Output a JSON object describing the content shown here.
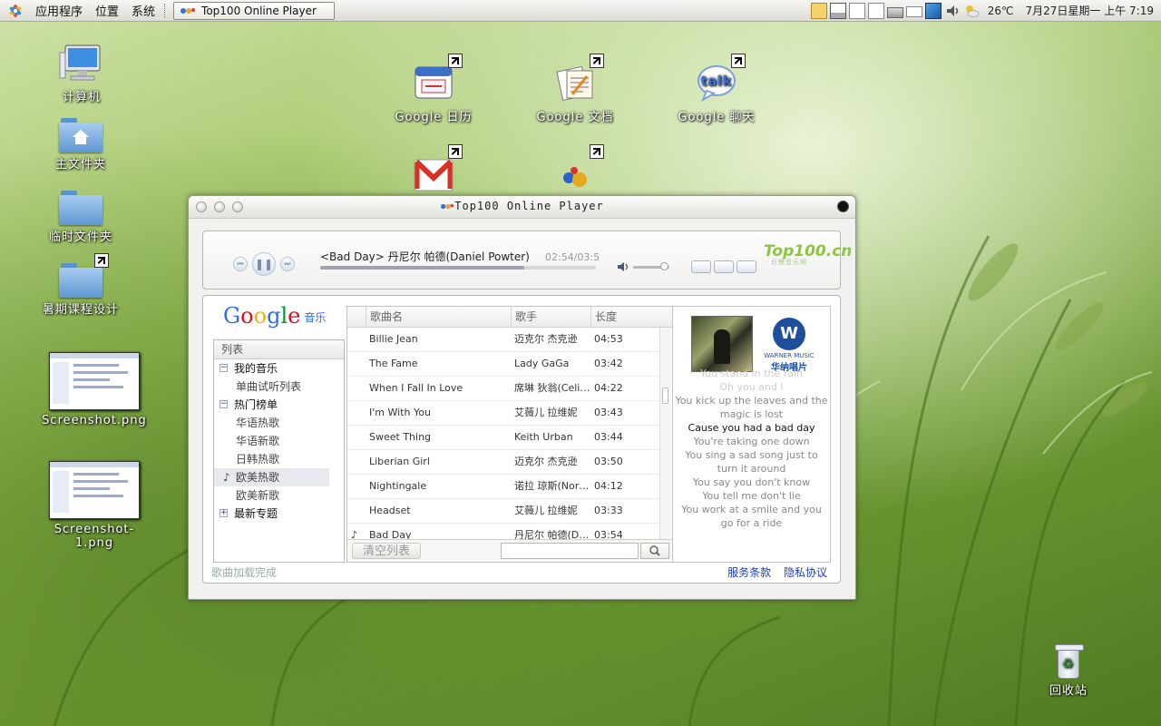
{
  "panel": {
    "menus": [
      "应用程序",
      "位置",
      "系统"
    ],
    "task_window": "Top100 Online Player",
    "weather": "26℃",
    "clock": "7月27日星期一 上午 7:19"
  },
  "desktop": {
    "icons_left": [
      "计算机",
      "主文件夹",
      "临时文件夹",
      "暑期课程设计"
    ],
    "thumb1": "Screenshot.png",
    "thumb2": "Screenshot-1.png",
    "google_calendar": "Google 日历",
    "google_docs": "Google 文档",
    "google_talk": "Google 聊天",
    "talk_bubble": "talk",
    "trash": "回收站"
  },
  "player": {
    "title": "Top100 Online Player",
    "now_playing": "<Bad Day>  丹尼尔 帕德(Daniel Powter)",
    "time": "02:54/03:5",
    "progress_fraction": 0.74,
    "volume_fraction": 0.85,
    "brand": "Top100.cn",
    "brand_sub": "巨鲸音乐网",
    "google_music": "音乐",
    "list_header": "列表",
    "tree": [
      {
        "label": "我的音乐",
        "type": "group",
        "toggle": "−"
      },
      {
        "label": "单曲试听列表",
        "type": "leaf"
      },
      {
        "label": "热门榜单",
        "type": "group",
        "toggle": "−"
      },
      {
        "label": "华语热歌",
        "type": "leaf"
      },
      {
        "label": "华语新歌",
        "type": "leaf"
      },
      {
        "label": "日韩热歌",
        "type": "leaf"
      },
      {
        "label": "欧美热歌",
        "type": "leaf",
        "active": true
      },
      {
        "label": "欧美新歌",
        "type": "leaf"
      },
      {
        "label": "最新专题",
        "type": "group",
        "toggle": "+"
      }
    ],
    "columns": [
      "歌曲名",
      "歌手",
      "长度"
    ],
    "songs": [
      {
        "title": "Billie Jean",
        "artist": "迈克尔 杰克逊",
        "length": "04:53"
      },
      {
        "title": "The Fame",
        "artist": "Lady GaGa",
        "length": "03:42"
      },
      {
        "title": "When I Fall In Love",
        "artist": "席琳 狄翁(Celine Dion)",
        "length": "04:22"
      },
      {
        "title": "I'm With You",
        "artist": "艾薇儿 拉维妮",
        "length": "03:43"
      },
      {
        "title": "Sweet Thing",
        "artist": "Keith Urban",
        "length": "03:44"
      },
      {
        "title": "Liberian Girl",
        "artist": "迈克尔 杰克逊",
        "length": "03:50"
      },
      {
        "title": "Nightingale",
        "artist": "诺拉 琼斯(Norah Jones)",
        "length": "04:12"
      },
      {
        "title": "Headset",
        "artist": "艾薇儿 拉维妮",
        "length": "03:33"
      },
      {
        "title": "Bad Day",
        "artist": "丹尼尔 帕德(Daniel Powter)",
        "length": "03:54",
        "playing": true
      }
    ],
    "clear_button": "清空列表",
    "search_placeholder": "",
    "label": "WARNER MUSIC",
    "label_cn": "华纳唱片",
    "lyrics_faint": "You stand in the rain",
    "lyrics": [
      {
        "text": "Oh you and I",
        "state": "faint"
      },
      {
        "text": "You kick up the leaves and the magic is lost",
        "state": "normal"
      },
      {
        "text": "Cause you had a bad day",
        "state": "current"
      },
      {
        "text": "You're taking one down",
        "state": "normal"
      },
      {
        "text": "You sing a sad song just to turn it around",
        "state": "normal"
      },
      {
        "text": "You say you don't know",
        "state": "normal"
      },
      {
        "text": "You tell me don't lie",
        "state": "normal"
      },
      {
        "text": "You work at a smile and you go for a ride",
        "state": "normal"
      }
    ],
    "status": "歌曲加载完成",
    "terms": "服务条款",
    "privacy": "隐私协议"
  },
  "colors": {
    "link": "#1b3fb4",
    "brand_green": "#8cc63f"
  }
}
